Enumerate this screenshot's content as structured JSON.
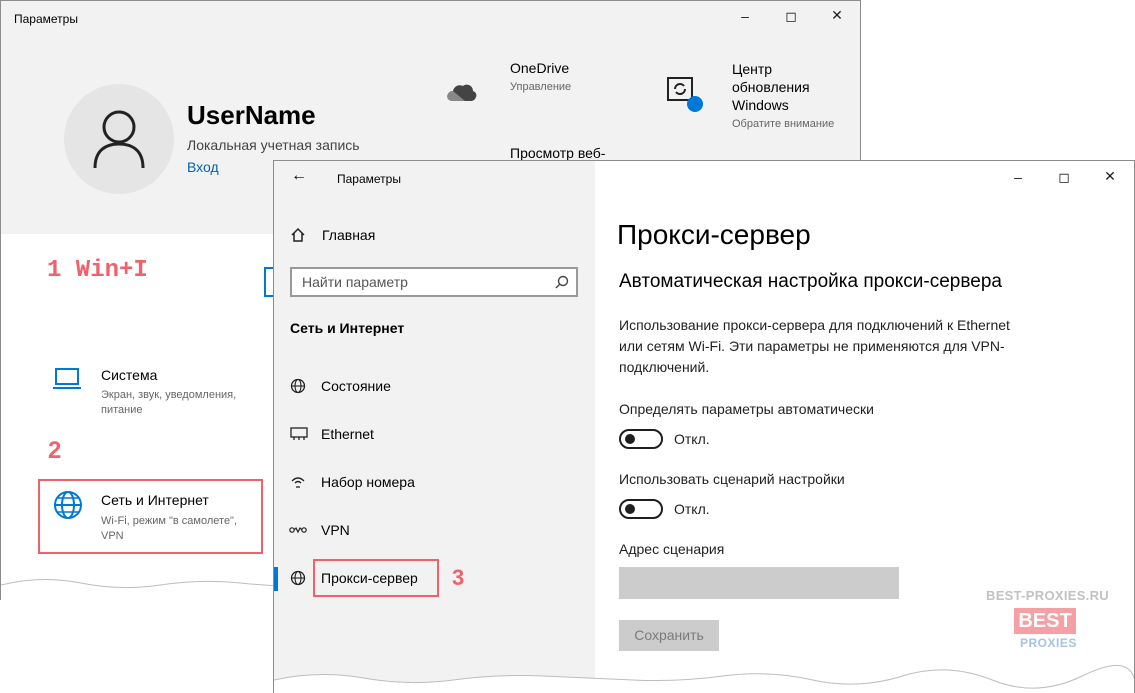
{
  "back_window": {
    "title": "Параметры",
    "user": {
      "name": "UserName",
      "account_type": "Локальная учетная запись",
      "signin_link": "Вход"
    },
    "onedrive": {
      "title": "OneDrive",
      "subtitle": "Управление"
    },
    "update": {
      "title_line1": "Центр",
      "title_line2": "обновления",
      "title_line3": "Windows",
      "subtitle": "Обратите внимание"
    },
    "browse": {
      "title": "Просмотр веб-"
    },
    "categories": [
      {
        "title": "Система",
        "desc_line1": "Экран, звук, уведомления,",
        "desc_line2": "питание"
      },
      {
        "title": "Сеть и Интернет",
        "desc_line1": "Wi-Fi, режим \"в самолете\",",
        "desc_line2": "VPN"
      }
    ]
  },
  "annotations": {
    "step1": "1 Win+I",
    "step2": "2",
    "step3": "3",
    "accent": "#f0626a"
  },
  "front_window": {
    "title": "Параметры",
    "home_label": "Главная",
    "search_placeholder": "Найти параметр",
    "section_title": "Сеть и Интернет",
    "nav_items": [
      {
        "label": "Состояние",
        "icon": "globe-status-icon"
      },
      {
        "label": "Ethernet",
        "icon": "ethernet-icon"
      },
      {
        "label": "Набор номера",
        "icon": "dialup-icon"
      },
      {
        "label": "VPN",
        "icon": "vpn-icon"
      },
      {
        "label": "Прокси-сервер",
        "icon": "globe-icon",
        "selected": true
      }
    ],
    "page_title": "Прокси-сервер",
    "auto_section_title": "Автоматическая настройка прокси-сервера",
    "auto_description_line1": "Использование прокси-сервера для подключений к Ethernet",
    "auto_description_line2": "или сетям Wi-Fi. Эти параметры не применяются для VPN-",
    "auto_description_line3": "подключений.",
    "auto_detect_label": "Определять параметры автоматически",
    "auto_detect_state": "Откл.",
    "use_script_label": "Использовать сценарий настройки",
    "use_script_state": "Откл.",
    "script_address_label": "Адрес сценария",
    "script_address_value": "",
    "save_button": "Сохранить"
  },
  "watermark": {
    "url": "BEST-PROXIES.RU",
    "brand_top": "BEST",
    "brand_bottom": "PROXIES"
  },
  "colors": {
    "accent_blue": "#0078d7",
    "link_blue": "#0063b1",
    "panel_gray": "#f2f2f2"
  }
}
